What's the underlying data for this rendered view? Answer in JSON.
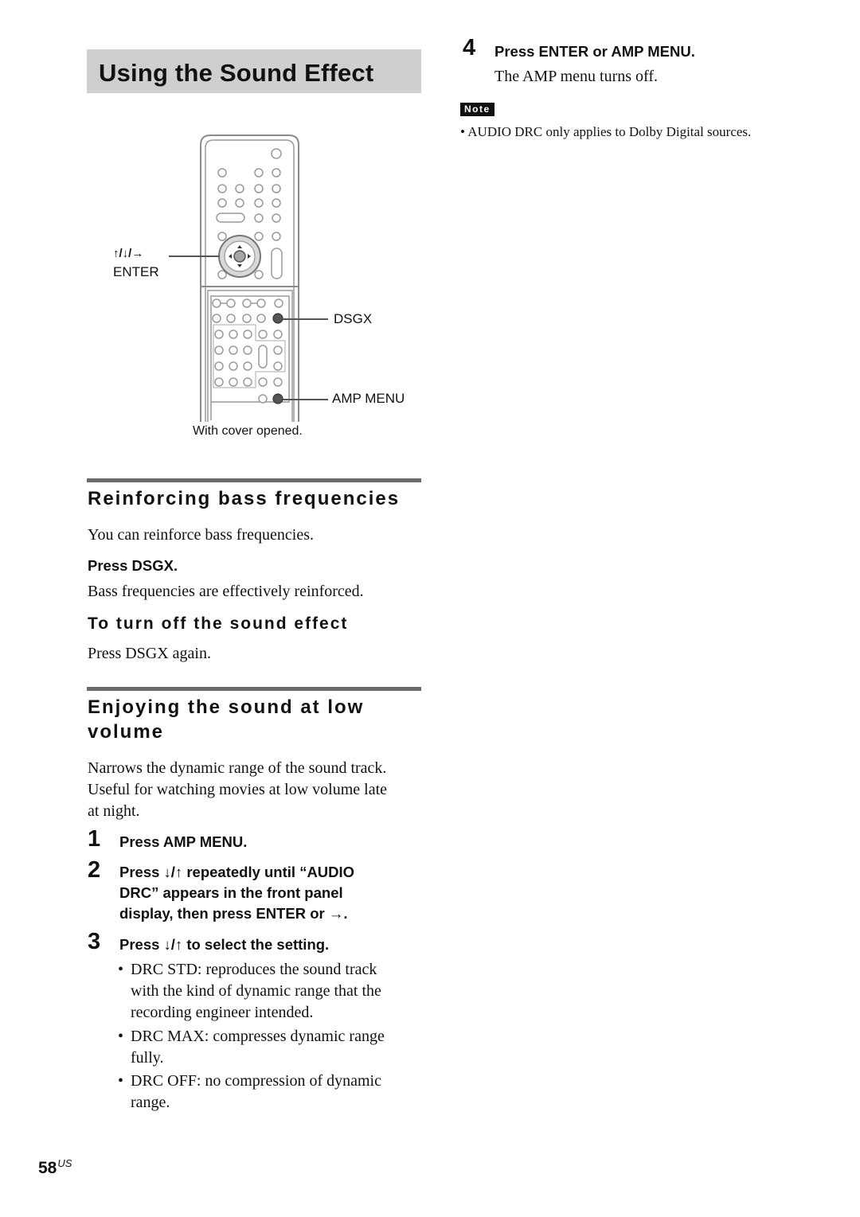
{
  "page": {
    "title": "Using the Sound Effect",
    "page_number": "58",
    "page_region": "US"
  },
  "figure": {
    "labels": {
      "arrows": "↑/↓/→",
      "enter": "ENTER",
      "dsgx": "DSGX",
      "amp_menu": "AMP MENU"
    },
    "caption": "With cover opened."
  },
  "reinforcing": {
    "heading": "Reinforcing bass frequencies",
    "intro": "You can reinforce bass frequencies.",
    "action": "Press DSGX.",
    "result": "Bass frequencies are effectively reinforced.",
    "subheading": "To turn off the sound effect",
    "subtext": "Press DSGX again."
  },
  "low_volume": {
    "heading_line1": "Enjoying the sound at low",
    "heading_line2": "volume",
    "intro_line1": "Narrows the dynamic range of the sound track.",
    "intro_line2": "Useful for watching movies at low volume late",
    "intro_line3": "at night.",
    "steps": [
      {
        "num": "1",
        "lines": [
          "Press AMP MENU."
        ]
      },
      {
        "num": "2",
        "lines": [
          "Press ↓/↑ repeatedly until “AUDIO",
          "DRC” appears in the front panel",
          "display, then press ENTER or →."
        ]
      },
      {
        "num": "3",
        "lines": [
          "Press ↓/↑ to select the setting."
        ]
      },
      {
        "num": "4",
        "lines": [
          "Press ENTER or AMP MENU."
        ],
        "result": "The AMP menu turns off."
      }
    ],
    "options": [
      {
        "lines": [
          "DRC STD: reproduces the sound track",
          "with the kind of dynamic range that the",
          "recording engineer intended."
        ]
      },
      {
        "lines": [
          "DRC MAX: compresses dynamic range",
          "fully."
        ]
      },
      {
        "lines": [
          "DRC OFF: no compression of dynamic",
          "range."
        ]
      }
    ]
  },
  "note": {
    "badge": "Note",
    "bullet": "•",
    "text": "AUDIO DRC only applies to Dolby Digital sources."
  },
  "bullet_char": "•"
}
